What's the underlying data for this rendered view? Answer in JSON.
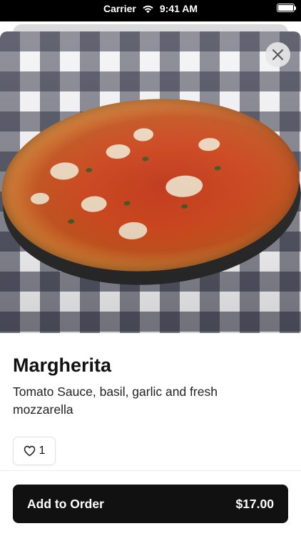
{
  "status_bar": {
    "carrier": "Carrier",
    "time": "9:41 AM",
    "icons": [
      "wifi-icon",
      "battery-icon"
    ]
  },
  "close_icon": "close-icon",
  "item": {
    "name": "Margherita",
    "description": "Tomato Sauce, basil, garlic and fresh mozzarella",
    "likes": "1",
    "like_icon": "heart-icon"
  },
  "order": {
    "label": "Add to Order",
    "price": "$17.00"
  },
  "colors": {
    "button_bg": "#111111",
    "button_text": "#ffffff"
  }
}
